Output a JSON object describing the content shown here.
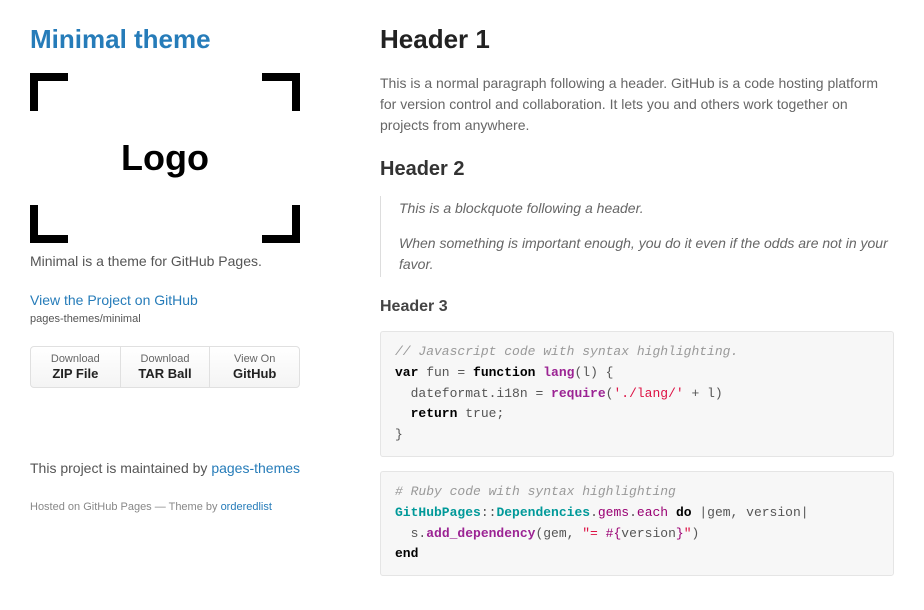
{
  "sidebar": {
    "title": "Minimal theme",
    "logo_text": "Logo",
    "tagline": "Minimal is a theme for GitHub Pages.",
    "github_link_text": "View the Project on GitHub",
    "repo_slug": "pages-themes/minimal",
    "buttons": [
      {
        "top": "Download",
        "bottom": "ZIP File"
      },
      {
        "top": "Download",
        "bottom": "TAR Ball"
      },
      {
        "top": "View On",
        "bottom": "GitHub"
      }
    ],
    "maintained_prefix": "This project is maintained by ",
    "maintained_link": "pages-themes",
    "footer_prefix": "Hosted on GitHub Pages — Theme by ",
    "footer_link": "orderedlist"
  },
  "main": {
    "h1": "Header 1",
    "para1": "This is a normal paragraph following a header. GitHub is a code hosting platform for version control and collaboration. It lets you and others work together on projects from anywhere.",
    "h2": "Header 2",
    "bq1": "This is a blockquote following a header.",
    "bq2": "When something is important enough, you do it even if the odds are not in your favor.",
    "h3": "Header 3",
    "js": {
      "comment": "// Javascript code with syntax highlighting.",
      "kw_var": "var",
      "id_fun": " fun ",
      "eq": "= ",
      "kw_function": "function",
      "fn_lang": " lang",
      "paren_l": "(l) {",
      "line2a": "  dateformat.i18n ",
      "eq2": "= ",
      "fn_require": "require",
      "paren2": "(",
      "str": "'./lang/'",
      "plus": " + l)",
      "kw_return": "  return",
      "true": " true",
      "semi": ";",
      "close": "}"
    },
    "rb": {
      "comment": "# Ruby code with syntax highlighting",
      "cls1": "GitHubPages",
      "sep1": "::",
      "cls2": "Dependencies",
      "dot1": ".",
      "m_gems": "gems",
      "dot2": ".",
      "m_each": "each",
      "sp": " ",
      "kw_do": "do",
      "pipe": " |gem, version|",
      "indent": "  s.",
      "m_add": "add_dependency",
      "open_p": "(gem, ",
      "str1": "\"= ",
      "interp": "#{",
      "ver": "version",
      "interp_close": "}",
      "str2": "\"",
      "close_p": ")",
      "kw_end": "end"
    }
  }
}
